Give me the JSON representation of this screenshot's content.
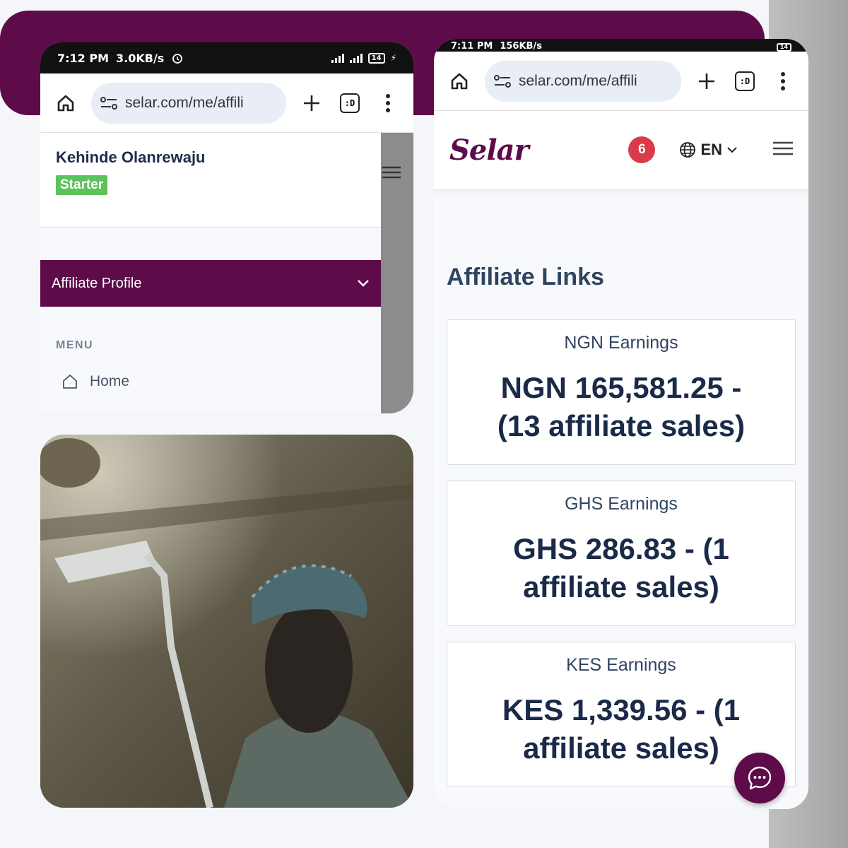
{
  "colors": {
    "brand": "#5e0b4a",
    "badge_green": "#5cc35c",
    "notification_red": "#d93b4a"
  },
  "left_phone": {
    "status": {
      "time": "7:12 PM",
      "speed": "3.0KB/s",
      "battery": "14"
    },
    "browser": {
      "url": "selar.com/me/affili",
      "tab_label": ":D"
    },
    "profile": {
      "name": "Kehinde Olanrewaju",
      "plan_badge": "Starter"
    },
    "affiliate_profile_label": "Affiliate Profile",
    "menu": {
      "heading": "MENU",
      "items": [
        {
          "label": "Home",
          "icon": "home-icon"
        }
      ]
    }
  },
  "right_phone": {
    "status": {
      "time": "7:11 PM",
      "speed": "156KB/s",
      "battery": "14"
    },
    "browser": {
      "url": "selar.com/me/affili",
      "tab_label": ":D"
    },
    "header": {
      "logo": "Selar",
      "notification_count": "6",
      "language": "EN"
    },
    "section_title": "Affiliate Links",
    "earnings": [
      {
        "label": "NGN Earnings",
        "value": "NGN 165,581.25 - (13 affiliate sales)"
      },
      {
        "label": "GHS Earnings",
        "value": "GHS 286.83 - (1 affiliate sales)"
      },
      {
        "label": "KES Earnings",
        "value": "KES 1,339.56 - (1 affiliate sales)"
      }
    ]
  }
}
